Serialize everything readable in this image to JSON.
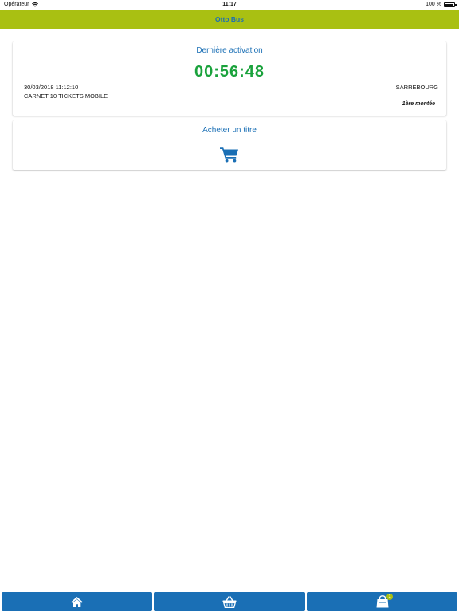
{
  "status_bar": {
    "carrier": "Opérateur",
    "time": "11:17",
    "battery": "100 %"
  },
  "header": {
    "title": "Otto Bus",
    "color": "#a9c012",
    "title_color": "#1a6fb5"
  },
  "activation_card": {
    "title": "Dernière activation",
    "countdown": "00:56:48",
    "date": "30/03/2018 11:12:10",
    "ticket_name": "CARNET 10 TICKETS MOBILE",
    "city": "SARREBOURG",
    "boarding": "1ère montée",
    "countdown_color": "#1aa23c"
  },
  "buy_card": {
    "title": "Acheter un titre",
    "icon": "cart-icon"
  },
  "bottom_nav": {
    "items": [
      {
        "icon": "home-icon"
      },
      {
        "icon": "basket-icon"
      },
      {
        "icon": "shopping-bag-icon",
        "badge": "1"
      }
    ],
    "color": "#1a6fb5"
  }
}
